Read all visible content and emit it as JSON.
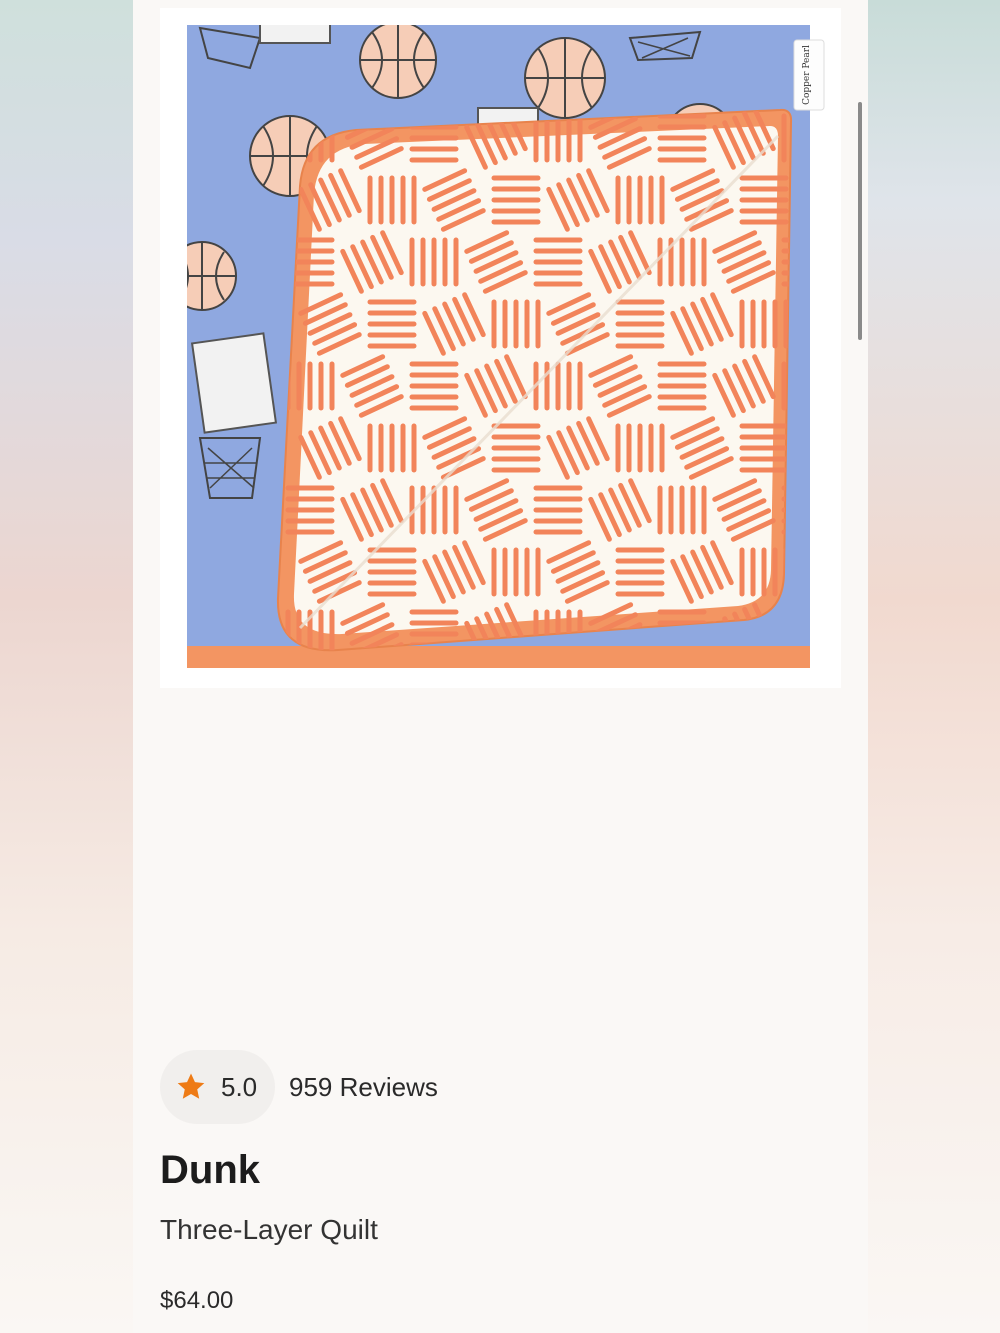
{
  "product": {
    "image_alt": "Basketball print three-layer quilt with orange trim, folded corner showing cream underside with orange dash pattern",
    "tag_text": "Copper Pearl",
    "rating": {
      "value": "5.0",
      "reviews_text": "959 Reviews",
      "star_color": "#ee7b16"
    },
    "name": "Dunk",
    "type": "Three-Layer Quilt",
    "price": "$64.00"
  },
  "colors": {
    "quilt_blue": "#8fa8e0",
    "trim_orange": "#f39562",
    "dash_orange": "#f2845a",
    "inner_cream": "#fcf8f0"
  }
}
